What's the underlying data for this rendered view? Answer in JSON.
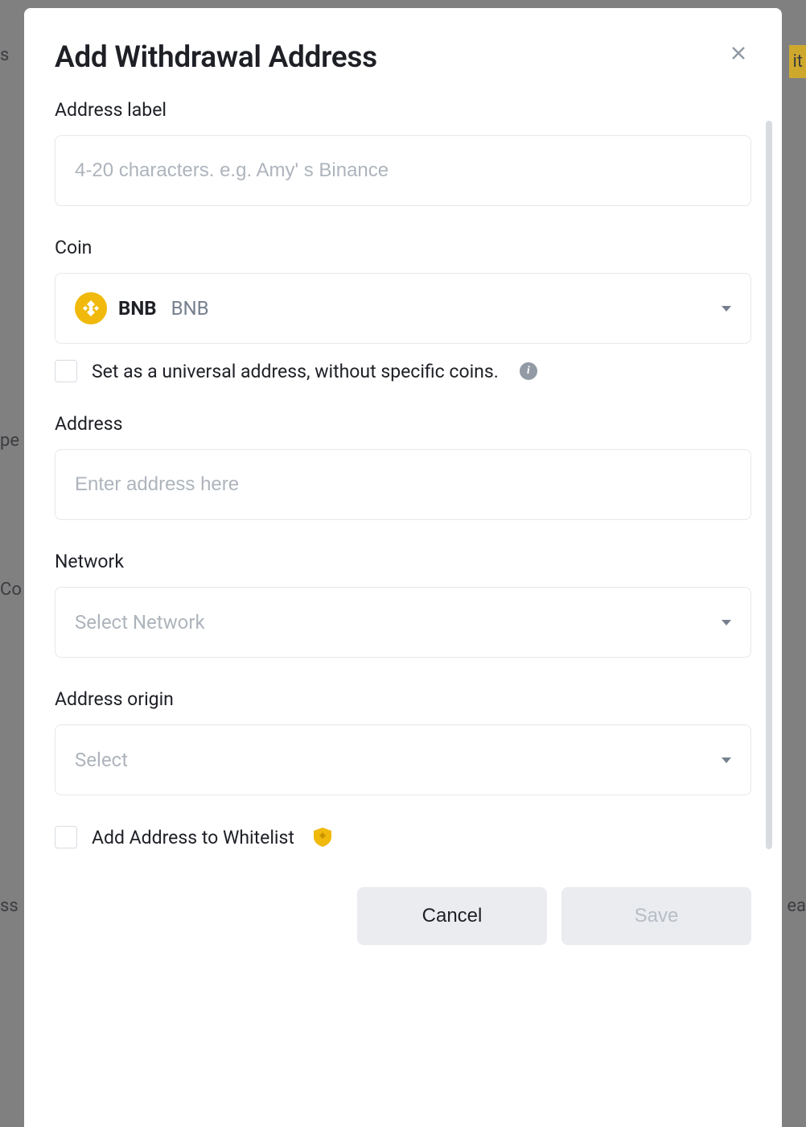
{
  "modal": {
    "title": "Add Withdrawal Address",
    "fields": {
      "address_label": {
        "label": "Address label",
        "placeholder": "4-20 characters. e.g. Amy' s Binance",
        "value": ""
      },
      "coin": {
        "label": "Coin",
        "selected_symbol": "BNB",
        "selected_name": "BNB",
        "icon": "bnb-icon"
      },
      "universal_checkbox": {
        "label": "Set as a universal address, without specific coins.",
        "checked": false
      },
      "address": {
        "label": "Address",
        "placeholder": "Enter address here",
        "value": ""
      },
      "network": {
        "label": "Network",
        "placeholder": "Select Network",
        "value": ""
      },
      "address_origin": {
        "label": "Address origin",
        "placeholder": "Select",
        "value": ""
      },
      "whitelist_checkbox": {
        "label": "Add Address to Whitelist",
        "checked": false
      }
    },
    "buttons": {
      "cancel": "Cancel",
      "save": "Save"
    }
  }
}
